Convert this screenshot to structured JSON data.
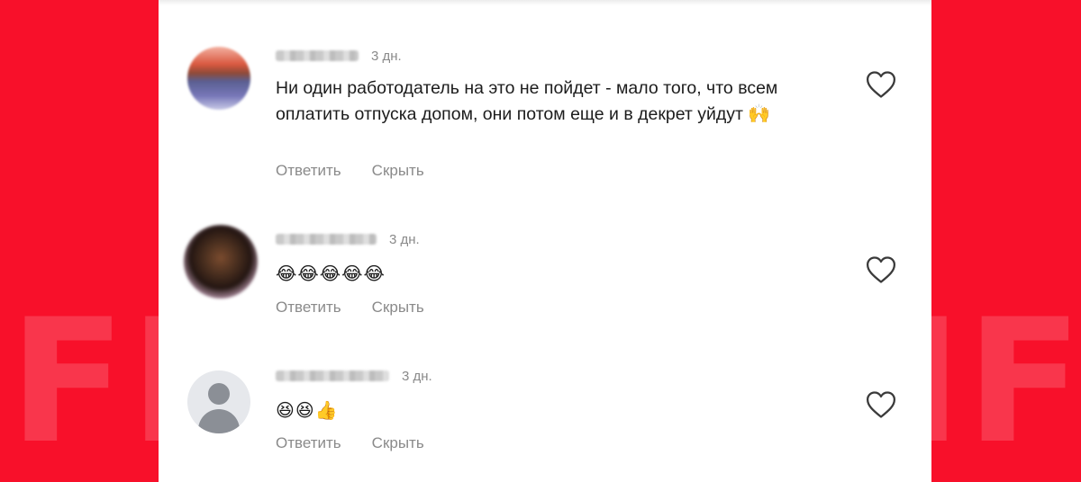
{
  "watermark": {
    "left": "FE",
    "right": "IF"
  },
  "comments": [
    {
      "time": "3 дн.",
      "text": "Ни один работодатель на это не пойдет - мало того, что всем оплатить отпуска допом, они потом еще и в декрет уйдут",
      "emoji": "🙌",
      "reply_label": "Ответить",
      "hide_label": "Скрыть"
    },
    {
      "time": "3 дн.",
      "text": "",
      "emoji": "😂😂😂😂😂",
      "reply_label": "Ответить",
      "hide_label": "Скрыть"
    },
    {
      "time": "3 дн.",
      "text": "",
      "emoji": "😆😆👍",
      "reply_label": "Ответить",
      "hide_label": "Скрыть"
    }
  ],
  "colors": {
    "background": "#f8102a",
    "card": "#ffffff",
    "meta_text": "#8a8a8a"
  },
  "icons": {
    "like": "heart-outline-icon",
    "avatar_placeholder": "user-silhouette-icon"
  }
}
